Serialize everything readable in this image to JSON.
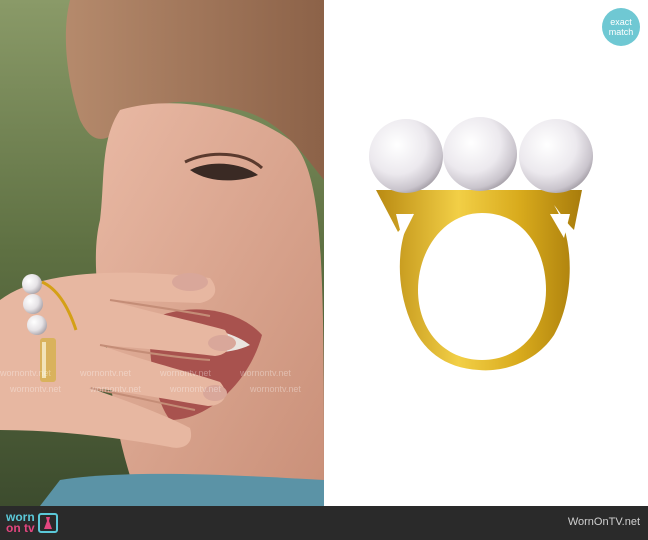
{
  "badge": {
    "line1": "exact",
    "line2": "match"
  },
  "footer": {
    "brand_top": "worn",
    "brand_bottom": "on tv",
    "site": "WornOnTV.net"
  },
  "watermark_text": "wornontv.net",
  "colors": {
    "badge": "#6fc8d3",
    "footer_bg": "#2a2a2a",
    "brand_teal": "#5bc8d8",
    "brand_pink": "#e2467f",
    "gold": "#d4a017"
  }
}
